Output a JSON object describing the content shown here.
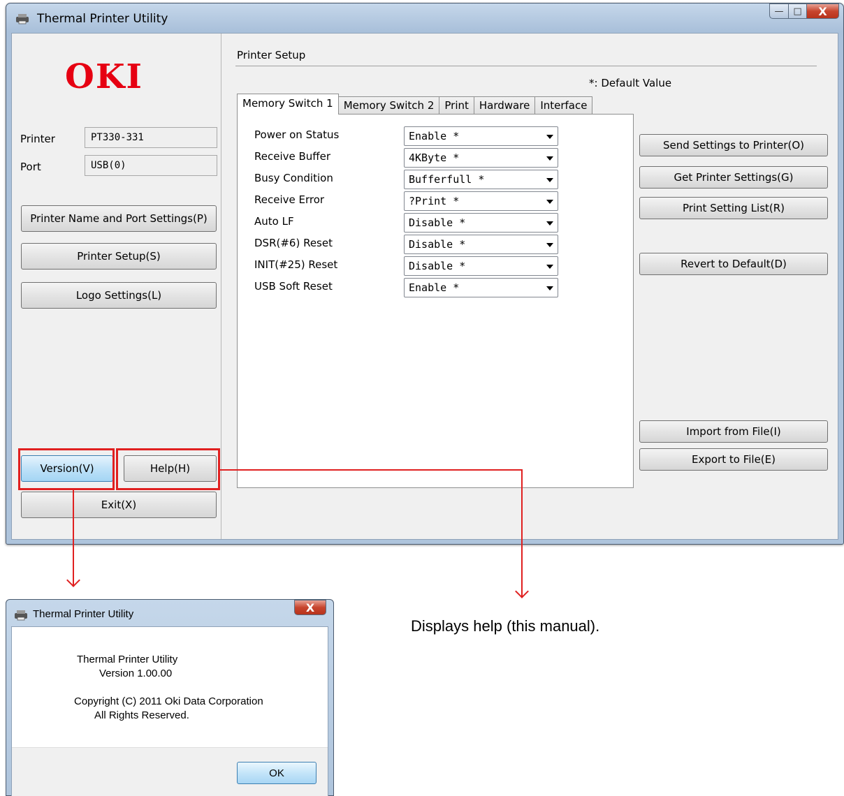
{
  "window": {
    "title": "Thermal Printer Utility",
    "caption": {
      "minimize": "—",
      "maximize": "□",
      "close": "X"
    }
  },
  "left": {
    "logo_text": "OKI",
    "printer_label": "Printer",
    "printer_value": "PT330-331",
    "port_label": "Port",
    "port_value": "USB(0)",
    "buttons": {
      "name_port": "Printer Name and Port Settings(P)",
      "printer_setup": "Printer Setup(S)",
      "logo_settings": "Logo Settings(L)",
      "version": "Version(V)",
      "help": "Help(H)",
      "exit": "Exit(X)"
    }
  },
  "setup": {
    "section_title": "Printer Setup",
    "default_note": "*: Default Value",
    "tabs": [
      "Memory Switch 1",
      "Memory Switch 2",
      "Print",
      "Hardware",
      "Interface"
    ],
    "rows": [
      {
        "label": "Power on Status",
        "value": "Enable *"
      },
      {
        "label": "Receive Buffer",
        "value": "4KByte *"
      },
      {
        "label": "Busy Condition",
        "value": "Bufferfull *"
      },
      {
        "label": "Receive Error",
        "value": "?Print *"
      },
      {
        "label": "Auto LF",
        "value": "Disable *"
      },
      {
        "label": "DSR(#6) Reset",
        "value": "Disable *"
      },
      {
        "label": "INIT(#25) Reset",
        "value": "Disable *"
      },
      {
        "label": "USB Soft Reset",
        "value": "Enable *"
      }
    ],
    "actions": {
      "send": "Send Settings to Printer(O)",
      "get": "Get Printer Settings(G)",
      "print_list": "Print Setting List(R)",
      "revert": "Revert to Default(D)",
      "import": "Import from File(I)",
      "export": "Export to File(E)"
    }
  },
  "about": {
    "title": "Thermal Printer Utility",
    "close": "X",
    "line1": "Thermal Printer Utility",
    "line2": "Version 1.00.00",
    "line3": "Copyright (C) 2011 Oki Data Corporation",
    "line4": "All Rights Reserved.",
    "ok": "OK"
  },
  "help_description": "Displays help (this manual).",
  "colors": {
    "accent_red": "#e02020",
    "oki_red": "#e60012"
  }
}
